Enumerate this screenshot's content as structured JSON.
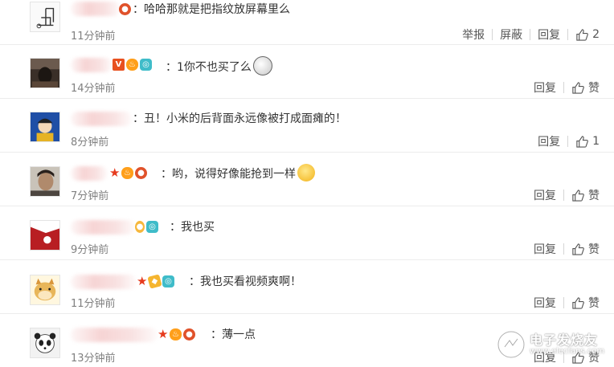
{
  "comments": [
    {
      "text": "：哈哈那就是把指纹放屏幕里么",
      "time": "11分钟前",
      "actions": [
        "举报",
        "屏蔽",
        "回复"
      ],
      "likes": "2",
      "avatar": "sketch-chair",
      "badges": [
        "red-badge"
      ]
    },
    {
      "text": "：1你不也买了么",
      "time": "14分钟前",
      "actions": [
        "回复"
      ],
      "likes": "赞",
      "avatar": "dark-photo",
      "badges": [
        "vip-badge",
        "fire-badge",
        "camera-badge"
      ],
      "emoji": "face-emoji"
    },
    {
      "text": "：丑！小米的后背面永远像被打成面瘫的！",
      "time": "8分钟前",
      "actions": [
        "回复"
      ],
      "likes": "1",
      "avatar": "cartoon-blue",
      "badges": []
    },
    {
      "text": "：哟，说得好像能抢到一样",
      "time": "7分钟前",
      "actions": [
        "回复"
      ],
      "likes": "赞",
      "avatar": "person-photo",
      "badges": [
        "star-badge",
        "fire-badge",
        "red-badge"
      ],
      "emoji": "laugh-emoji"
    },
    {
      "text": "：我也买",
      "time": "9分钟前",
      "actions": [
        "回复"
      ],
      "likes": "赞",
      "avatar": "red-photo",
      "badges": [
        "medal-badge",
        "camera-badge"
      ]
    },
    {
      "text": "：我也买看视频爽啊！",
      "time": "11分钟前",
      "actions": [
        "回复"
      ],
      "likes": "赞",
      "avatar": "doge",
      "badges": [
        "star-badge",
        "gold-badge",
        "camera-badge"
      ]
    },
    {
      "text": "：薄一点",
      "time": "13分钟前",
      "actions": [
        "回复"
      ],
      "likes": "赞",
      "avatar": "panda",
      "badges": [
        "star-badge",
        "fire-badge",
        "red-badge"
      ]
    }
  ],
  "watermark": {
    "cn": "电子发烧友",
    "en": "www.elecfans.com"
  },
  "colors": {
    "text": "#333333",
    "time": "#808080",
    "divider": "#ececec",
    "star": "#e63b1e"
  }
}
